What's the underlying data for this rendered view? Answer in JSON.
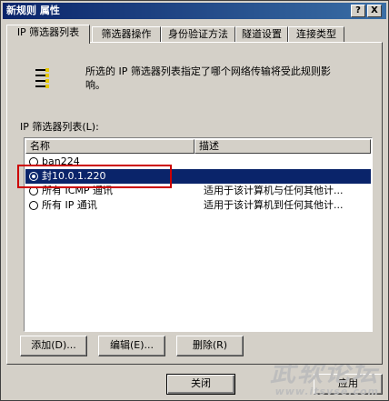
{
  "window": {
    "title": "新规则 属性",
    "help_glyph": "?",
    "close_glyph": "X"
  },
  "tabs": [
    {
      "label": "IP 筛选器列表"
    },
    {
      "label": "筛选器操作"
    },
    {
      "label": "身份验证方法"
    },
    {
      "label": "隧道设置"
    },
    {
      "label": "连接类型"
    }
  ],
  "panel": {
    "description": "所选的 IP 筛选器列表指定了哪个网络传输将受此规则影响。",
    "list_label": "IP 筛选器列表(L):",
    "columns": {
      "name": "名称",
      "desc": "描述"
    },
    "rows": [
      {
        "name": "ban224",
        "desc": "",
        "checked": false
      },
      {
        "name": "封10.0.1.220",
        "desc": "",
        "checked": true
      },
      {
        "name": "所有 ICMP 通讯",
        "desc": "适用于该计算机与任何其他计...",
        "checked": false
      },
      {
        "name": "所有 IP 通讯",
        "desc": "适用于该计算机到任何其他计...",
        "checked": false
      }
    ],
    "buttons": {
      "add": "添加(D)...",
      "edit": "编辑(E)...",
      "remove": "删除(R)"
    }
  },
  "footer": {
    "close": "关闭",
    "apply": "应用"
  },
  "watermark": {
    "title": "武软论坛",
    "url": "www.itsvse.com"
  },
  "colors": {
    "selection": "#0a246a",
    "highlight_box": "#cc0000",
    "face": "#d4d0c8"
  }
}
